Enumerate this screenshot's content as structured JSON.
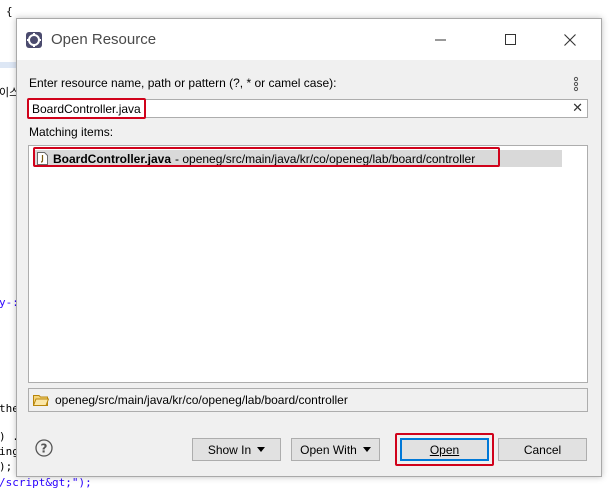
{
  "background_code": {
    "lines": [
      "{",
      "이스",
      "y-:",
      "the",
      ") .",
      "ing",
      ");",
      "/script&gt;\");"
    ]
  },
  "dialog": {
    "title": "Open Resource",
    "prompt_label": "Enter resource name, path or pattern (?, * or camel case):",
    "search": {
      "value": "BoardController.java",
      "placeholder": ""
    },
    "matching_label": "Matching items:",
    "items": [
      {
        "name": "BoardController.java",
        "path": "- openeg/src/main/java/kr/co/openeg/lab/board/controller"
      }
    ],
    "status_path": "openeg/src/main/java/kr/co/openeg/lab/board/controller",
    "buttons": {
      "show_in": "Show In",
      "open_with": "Open With",
      "open": "Open",
      "cancel": "Cancel"
    }
  },
  "colors": {
    "highlight": "#d0021b",
    "default_button_border": "#0078d7",
    "selection": "#d9d9d9"
  }
}
